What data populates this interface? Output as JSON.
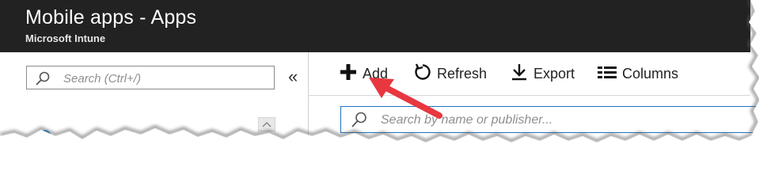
{
  "header": {
    "title": "Mobile apps - Apps",
    "subtitle": "Microsoft Intune"
  },
  "sidebar": {
    "search_placeholder": "Search (Ctrl+/)",
    "collapse_icon": "double-chevron-left-icon",
    "collapse_glyph": "«"
  },
  "toolbar": {
    "add_label": "Add",
    "refresh_label": "Refresh",
    "export_label": "Export",
    "columns_label": "Columns"
  },
  "apps_search": {
    "placeholder": "Search by name or publisher..."
  },
  "colors": {
    "header_bg": "#222222",
    "search_border_active": "#1e73be",
    "annotation_arrow": "#e8373f"
  }
}
